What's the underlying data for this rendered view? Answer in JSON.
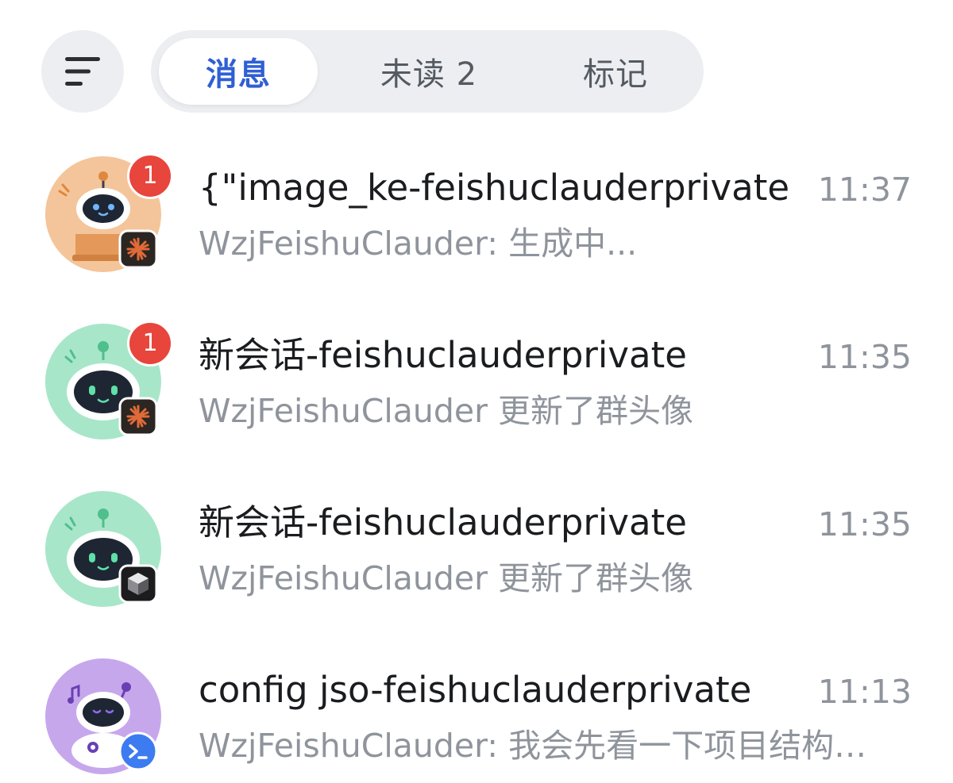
{
  "header": {
    "menu_icon": "hamburger-menu-icon",
    "tabs": [
      {
        "label": "消息",
        "active": true
      },
      {
        "label": "未读 2",
        "active": false
      },
      {
        "label": "标记",
        "active": false
      }
    ]
  },
  "colors": {
    "accent": "#2f5fd3",
    "badge": "#e8453c",
    "muted_text": "#8f949c",
    "title_text": "#1b1c1f",
    "pill_bg": "#eceef1"
  },
  "conversations": [
    {
      "title": "{\"image_ke-feishuclauderprivate",
      "time": "11:37",
      "preview": "WzjFeishuClauder: 生成中...",
      "unread": "1",
      "avatar_icon": "robot-laptop-avatar-icon",
      "app_icon": "claude-starburst-icon"
    },
    {
      "title": "新会话-feishuclauderprivate",
      "time": "11:35",
      "preview": "WzjFeishuClauder 更新了群头像",
      "unread": "1",
      "avatar_icon": "robot-green-avatar-icon",
      "app_icon": "claude-starburst-icon"
    },
    {
      "title": "新会话-feishuclauderprivate",
      "time": "11:35",
      "preview": "WzjFeishuClauder 更新了群头像",
      "unread": "",
      "avatar_icon": "robot-green-avatar-icon",
      "app_icon": "cube-icon"
    },
    {
      "title": "config jso-feishuclauderprivate",
      "time": "11:13",
      "preview": "WzjFeishuClauder: 我会先看一下项目结构…",
      "unread": "",
      "avatar_icon": "robot-purple-avatar-icon",
      "app_icon": "terminal-icon"
    }
  ]
}
